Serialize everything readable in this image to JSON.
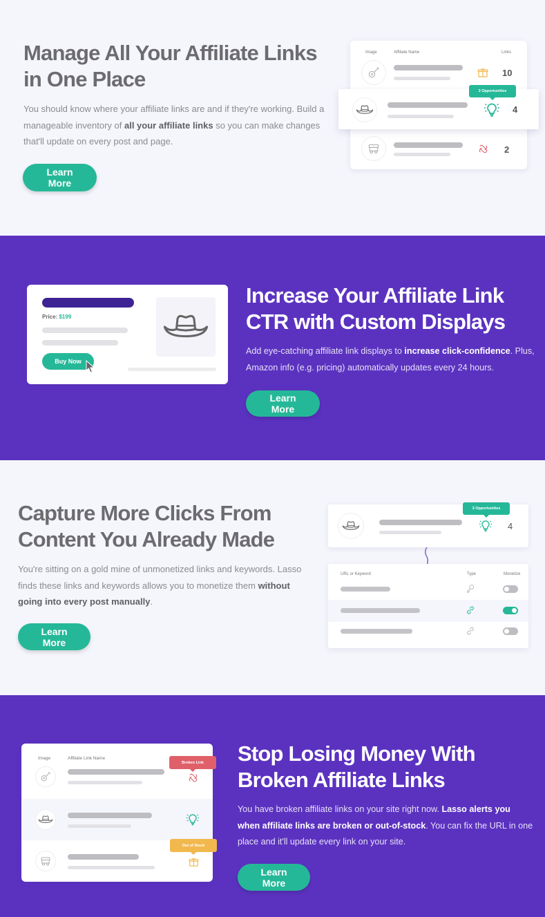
{
  "colors": {
    "accent": "#25b898",
    "purple": "#5b32c0",
    "light_bg": "#f5f5fc",
    "broken": "#e0606a",
    "out_of_stock": "#f1b84d"
  },
  "sections": [
    {
      "heading_line1": "Manage All Your Affiliate Links",
      "heading_line2": "in One Place",
      "body_pre": "You should know where your affiliate links are and if they're working. Build a manageable inventory of ",
      "body_bold": "all your affiliate links",
      "body_post": " so you can make changes that'll update on every post and page.",
      "button": "Learn More",
      "mock": {
        "headers": [
          "Image",
          "Affiliate Name",
          "Links"
        ],
        "rows": [
          {
            "icon": "guitar-icon",
            "status_icon": "box-icon",
            "count": "10"
          },
          {
            "icon": "hat-icon",
            "status_icon": "lightbulb-icon",
            "count": "4",
            "tooltip": "3 Opportunities"
          },
          {
            "icon": "wagon-icon",
            "status_icon": "broken-link-icon",
            "count": "2"
          }
        ]
      }
    },
    {
      "heading_line1": "Increase Your Affiliate Link",
      "heading_line2": "CTR with Custom Displays",
      "body_pre": "Add eye-catching affiliate link displays to ",
      "body_bold": "increase click-confidence",
      "body_post": ". Plus, Amazon info (e.g. pricing) automatically updates every 24 hours.",
      "button": "Learn More",
      "mock": {
        "price_label": "Price:",
        "price_value": "$199",
        "buy_button": "Buy Now",
        "product_icon": "hat-icon"
      }
    },
    {
      "heading_line1": "Capture More Clicks From",
      "heading_line2": "Content You Already Made",
      "body_pre": "You're sitting on a gold mine of unmonetized links and keywords. Lasso finds these links and keywords allows you to monetize them ",
      "body_bold": "without going into every post manually",
      "body_post": ".",
      "button": "Learn More",
      "mock": {
        "top_row": {
          "icon": "hat-icon",
          "status_icon": "lightbulb-icon",
          "count": "4",
          "tooltip": "3 Opportunities"
        },
        "headers": [
          "URL or Keyword",
          "Type",
          "Monetize"
        ],
        "rows": [
          {
            "type_icon": "key-icon",
            "monetize": false
          },
          {
            "type_icon": "link-icon",
            "monetize": true
          },
          {
            "type_icon": "link-icon",
            "monetize": false
          }
        ]
      }
    },
    {
      "heading_line1": "Stop Losing Money With",
      "heading_line2": "Broken Affiliate Links",
      "body_pre": "You have broken affiliate links on your site right now. ",
      "body_bold": "Lasso alerts you when affiliate links are broken or out-of-stock",
      "body_post": ". You can fix the URL in one place and it'll update every link on your site.",
      "button": "Learn More",
      "mock": {
        "headers": [
          "Image",
          "Affiliate Link Name"
        ],
        "rows": [
          {
            "icon": "guitar-icon",
            "status_icon": "broken-link-icon",
            "tooltip": "Broken Link"
          },
          {
            "icon": "hat-icon",
            "status_icon": "lightbulb-icon"
          },
          {
            "icon": "wagon-icon",
            "status_icon": "box-icon",
            "tooltip": "Out of Stock"
          }
        ]
      }
    }
  ]
}
